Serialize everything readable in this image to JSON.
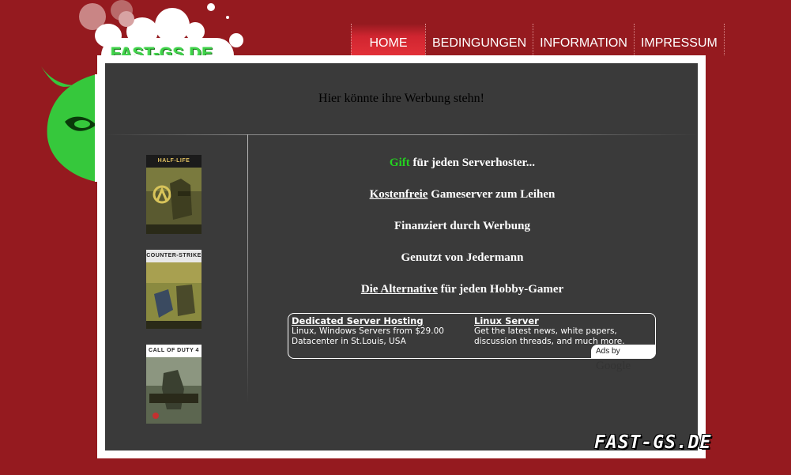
{
  "brand": {
    "logo_text": "FAST-GS.DE",
    "footer_logo_text": "FAST-GS.DE"
  },
  "nav": {
    "items": [
      {
        "label": "HOME",
        "active": true
      },
      {
        "label": "BEDINGUNGEN"
      },
      {
        "label": "INFORMATION"
      },
      {
        "label": "IMPRESSUM"
      }
    ]
  },
  "promo": {
    "text": "Hier könnte ihre Werbung stehn!"
  },
  "games": [
    {
      "title": "HALF-LIFE"
    },
    {
      "title": "COUNTER-STRIKE"
    },
    {
      "title": "CALL OF DUTY 4"
    }
  ],
  "main": {
    "line1": {
      "highlight": "Gift",
      "rest": " für jeden Serverhoster..."
    },
    "line2": {
      "link": "Kostenfreie",
      "rest": " Gameserver zum Leihen"
    },
    "line3": "Finanziert durch Werbung",
    "line4": "Genutzt von Jedermann",
    "line5": {
      "link": "Die Alternative",
      "rest": " für jeden Hobby-Gamer"
    }
  },
  "ads": {
    "items": [
      {
        "title": "Dedicated Server Hosting",
        "line1": "Linux, Windows Servers from $29.00",
        "line2": "Datacenter in St.Louis, USA"
      },
      {
        "title": "Linux Server",
        "line1": "Get the latest news, white papers,",
        "line2": "discussion threads, and much more."
      }
    ],
    "ads_by_label": "Ads by",
    "ads_by_brand": "Google"
  },
  "colors": {
    "background": "#951a1f",
    "panel": "#3a3a3a",
    "accent_green": "#23d21f",
    "nav_active": "#e23038"
  }
}
